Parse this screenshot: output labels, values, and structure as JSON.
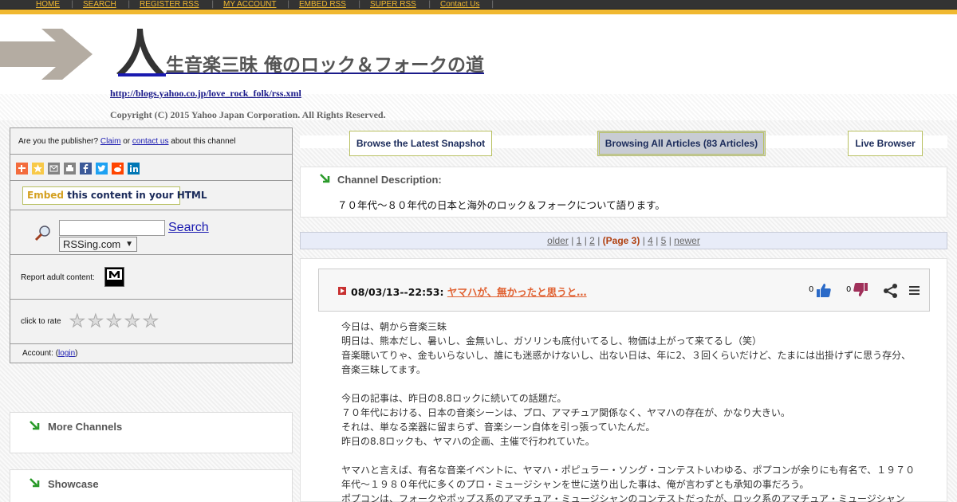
{
  "nav": {
    "items": [
      "HOME",
      "SEARCH",
      "REGISTER RSS",
      "MY ACCOUNT",
      "EMBED RSS",
      "SUPER RSS",
      "Contact Us"
    ],
    "separator": "|"
  },
  "header": {
    "title": "生音楽三昧 俺のロック＆フォークの道",
    "feed_url": "http://blogs.yahoo.co.jp/love_rock_folk/rss.xml",
    "copyright": "Copyright (C) 2015 Yahoo Japan Corporation. All Rights Reserved."
  },
  "sidebar": {
    "publisher_prefix": "Are you the publisher?",
    "claim": "Claim",
    "or": "or",
    "contact_us": "contact us",
    "publisher_suffix": "about this channel",
    "share_icons": [
      "plus-icon",
      "star-icon",
      "mail-icon",
      "print-icon",
      "facebook-icon",
      "twitter-icon",
      "reddit-icon",
      "linkedin-icon"
    ],
    "embed_word": "Embed",
    "embed_rest": "this content in your HTML",
    "search_label": "Search",
    "search_value": "",
    "search_scope": "RSSing.com",
    "report_label": "Report adult content:",
    "rate_label": "click to rate",
    "account_prefix": "Account: (",
    "login": "login",
    "account_suffix": ")",
    "more_channels": "More Channels",
    "showcase": "Showcase"
  },
  "tabs": {
    "snapshot": "Browse the Latest Snapshot",
    "all": "Browsing All Articles (83 Articles)",
    "live": "Live Browser"
  },
  "channel": {
    "title": "Channel Description:",
    "description": "７０年代～８０年代の日本と海外のロック＆フォークについて語ります。"
  },
  "pager": {
    "older": "older",
    "p1": "1",
    "p2": "2",
    "current": "(Page 3)",
    "p4": "4",
    "p5": "5",
    "newer": "newer",
    "sep": "|"
  },
  "article": {
    "date": "08/03/13--22:53:",
    "title": "ヤマハが、無かったと思うと…",
    "likes": "0",
    "dislikes": "0",
    "paragraphs": [
      [
        "今日は、朝から音楽三昧",
        "明日は、熊本だし、暑いし、金無いし、ガソリンも底付いてるし、物価は上がって来てるし（笑）",
        "音楽聴いてりゃ、金もいらないし、誰にも迷惑かけないし、出ない日は、年に2、３回くらいだけど、たまには出掛けずに思う存分、音楽三昧してます。"
      ],
      [
        "今日の記事は、昨日の8.8ロックに続いての話題だ。",
        "７０年代における、日本の音楽シーンは、プロ、アマチュア関係なく、ヤマハの存在が、かなり大きい。",
        "それは、単なる楽器に留まらず、音楽シーン自体を引っ張っていたんだ。",
        "昨日の8.8ロックも、ヤマハの企画、主催で行われていた。"
      ],
      [
        "ヤマハと言えば、有名な音楽イベントに、ヤマハ・ポピュラー・ソング・コンテストいわゆる、ポプコンが余りにも有名で、１９７０年代～１９８０年代に多くのプロ・ミュージシャンを世に送り出した事は、俺が言わずとも承知の事だろう。",
        "ポプコンは、フォークやポップス系のアマチュア・ミュージシャンのコンテストだったが、ロック系のアマチュア・ミュージシャン"
      ]
    ]
  }
}
